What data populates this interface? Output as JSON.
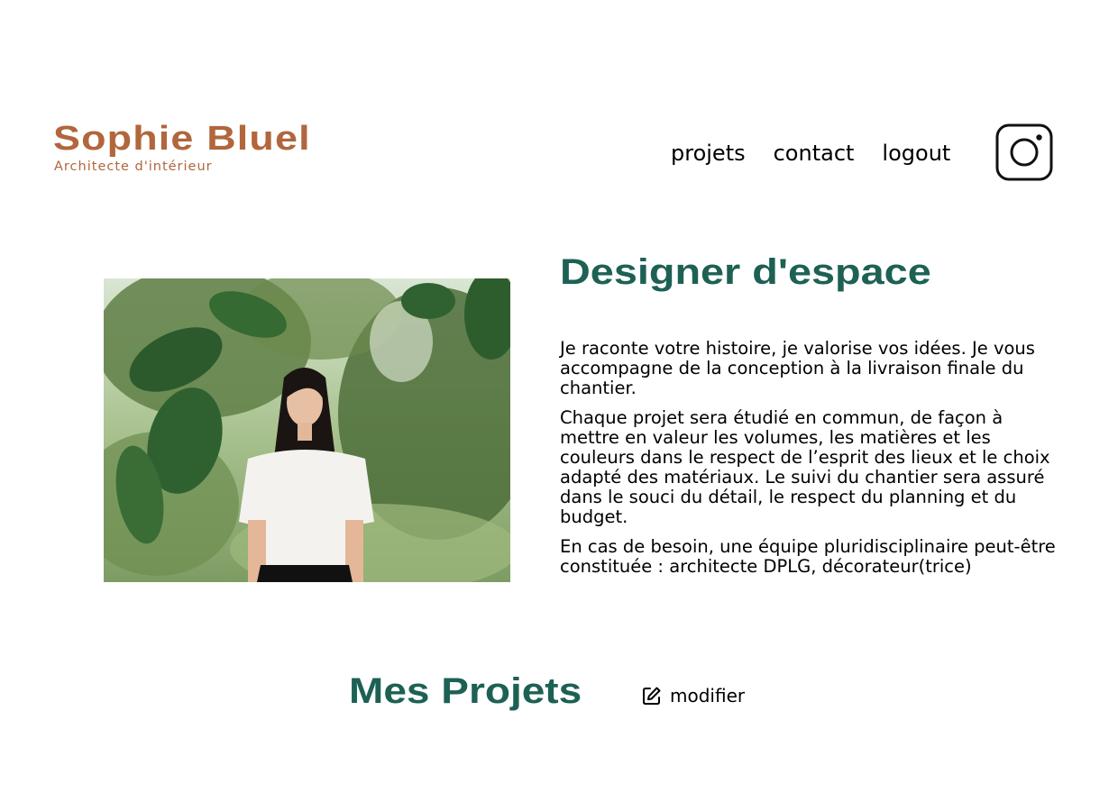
{
  "header": {
    "brand_name": "Sophie Bluel",
    "brand_tagline": "Architecte d'intérieur",
    "nav": {
      "projects": "projets",
      "contact": "contact",
      "logout": "logout"
    },
    "social_icon": "instagram-icon"
  },
  "introduction": {
    "title": "Designer d'espace",
    "paragraphs": [
      "Je raconte votre histoire, je valorise vos idées. Je vous accompagne de la conception à la livraison finale du chantier.",
      "Chaque projet sera étudié en commun, de façon à mettre en valeur les volumes, les matières et les couleurs dans le respect de l’esprit des lieux et le choix adapté des matériaux. Le suivi du chantier sera assuré dans le souci du détail, le respect du planning et du budget.",
      "En cas de besoin, une équipe pluridisciplinaire peut-être constituée : architecte DPLG, décorateur(trice)"
    ]
  },
  "portfolio": {
    "title": "Mes Projets",
    "edit_label": "modifier",
    "edit_icon": "pen-to-square-icon"
  },
  "colors": {
    "brand": "#B1663C",
    "accent": "#1D6154"
  }
}
